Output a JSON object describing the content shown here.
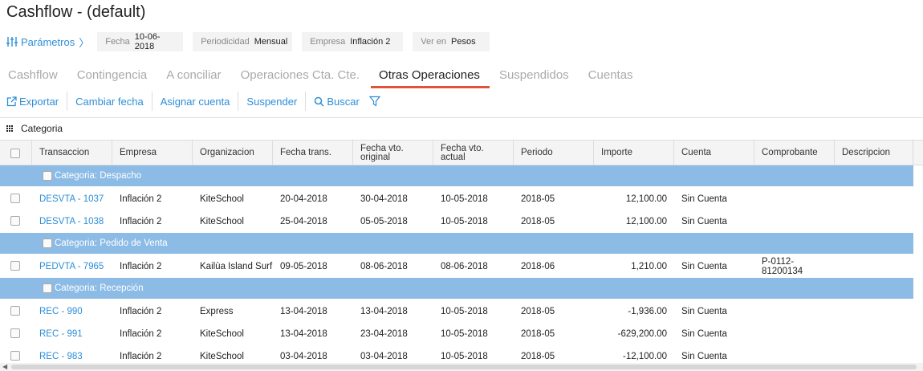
{
  "title": "Cashflow - (default)",
  "params": {
    "link_label": "Parámetros",
    "chips": [
      {
        "label": "Fecha",
        "value": "10-06-2018"
      },
      {
        "label": "Periodicidad",
        "value": "Mensual"
      },
      {
        "label": "Empresa",
        "value": "Inflación 2"
      },
      {
        "label": "Ver en",
        "value": "Pesos"
      }
    ]
  },
  "tabs": [
    {
      "label": "Cashflow",
      "active": false
    },
    {
      "label": "Contingencia",
      "active": false
    },
    {
      "label": "A conciliar",
      "active": false
    },
    {
      "label": "Operaciones Cta. Cte.",
      "active": false
    },
    {
      "label": "Otras Operaciones",
      "active": true
    },
    {
      "label": "Suspendidos",
      "active": false
    },
    {
      "label": "Cuentas",
      "active": false
    }
  ],
  "toolbar": {
    "export": "Exportar",
    "change_date": "Cambiar fecha",
    "assign_account": "Asignar cuenta",
    "suspend": "Suspender",
    "search": "Buscar"
  },
  "grouping": {
    "label": "Categoria"
  },
  "columns": [
    "Transaccion",
    "Empresa",
    "Organizacion",
    "Fecha trans.",
    "Fecha vto.\noriginal",
    "Fecha vto.\nactual",
    "Periodo",
    "Importe",
    "Cuenta",
    "Comprobante",
    "Descripcion"
  ],
  "groups": [
    {
      "label": "Categoria: Despacho",
      "rows": [
        [
          "DESVTA - 1037",
          "Inflación 2",
          "KiteSchool",
          "20-04-2018",
          "30-04-2018",
          "10-05-2018",
          "2018-05",
          "12,100.00",
          "Sin Cuenta",
          "",
          ""
        ],
        [
          "DESVTA - 1038",
          "Inflación 2",
          "KiteSchool",
          "25-04-2018",
          "05-05-2018",
          "10-05-2018",
          "2018-05",
          "12,100.00",
          "Sin Cuenta",
          "",
          ""
        ]
      ]
    },
    {
      "label": "Categoria: Pedido de Venta",
      "rows": [
        [
          "PEDVTA - 7965",
          "Inflación 2",
          "Kailùa Island Surf",
          "09-05-2018",
          "08-06-2018",
          "08-06-2018",
          "2018-06",
          "1,210.00",
          "Sin Cuenta",
          "P-0112-81200134",
          ""
        ]
      ]
    },
    {
      "label": "Categoria: Recepción",
      "rows": [
        [
          "REC - 990",
          "Inflación 2",
          "Express",
          "13-04-2018",
          "13-04-2018",
          "10-05-2018",
          "2018-05",
          "-1,936.00",
          "Sin Cuenta",
          "",
          ""
        ],
        [
          "REC - 991",
          "Inflación 2",
          "KiteSchool",
          "13-04-2018",
          "23-04-2018",
          "10-05-2018",
          "2018-05",
          "-629,200.00",
          "Sin Cuenta",
          "",
          ""
        ],
        [
          "REC - 983",
          "Inflación 2",
          "KiteSchool",
          "03-04-2018",
          "03-04-2018",
          "10-05-2018",
          "2018-05",
          "-12,100.00",
          "Sin Cuenta",
          "",
          ""
        ]
      ]
    }
  ],
  "colors": {
    "accent": "#2d8ed8",
    "tab_underline": "#e0523b",
    "group_row": "#8cbbe6"
  }
}
